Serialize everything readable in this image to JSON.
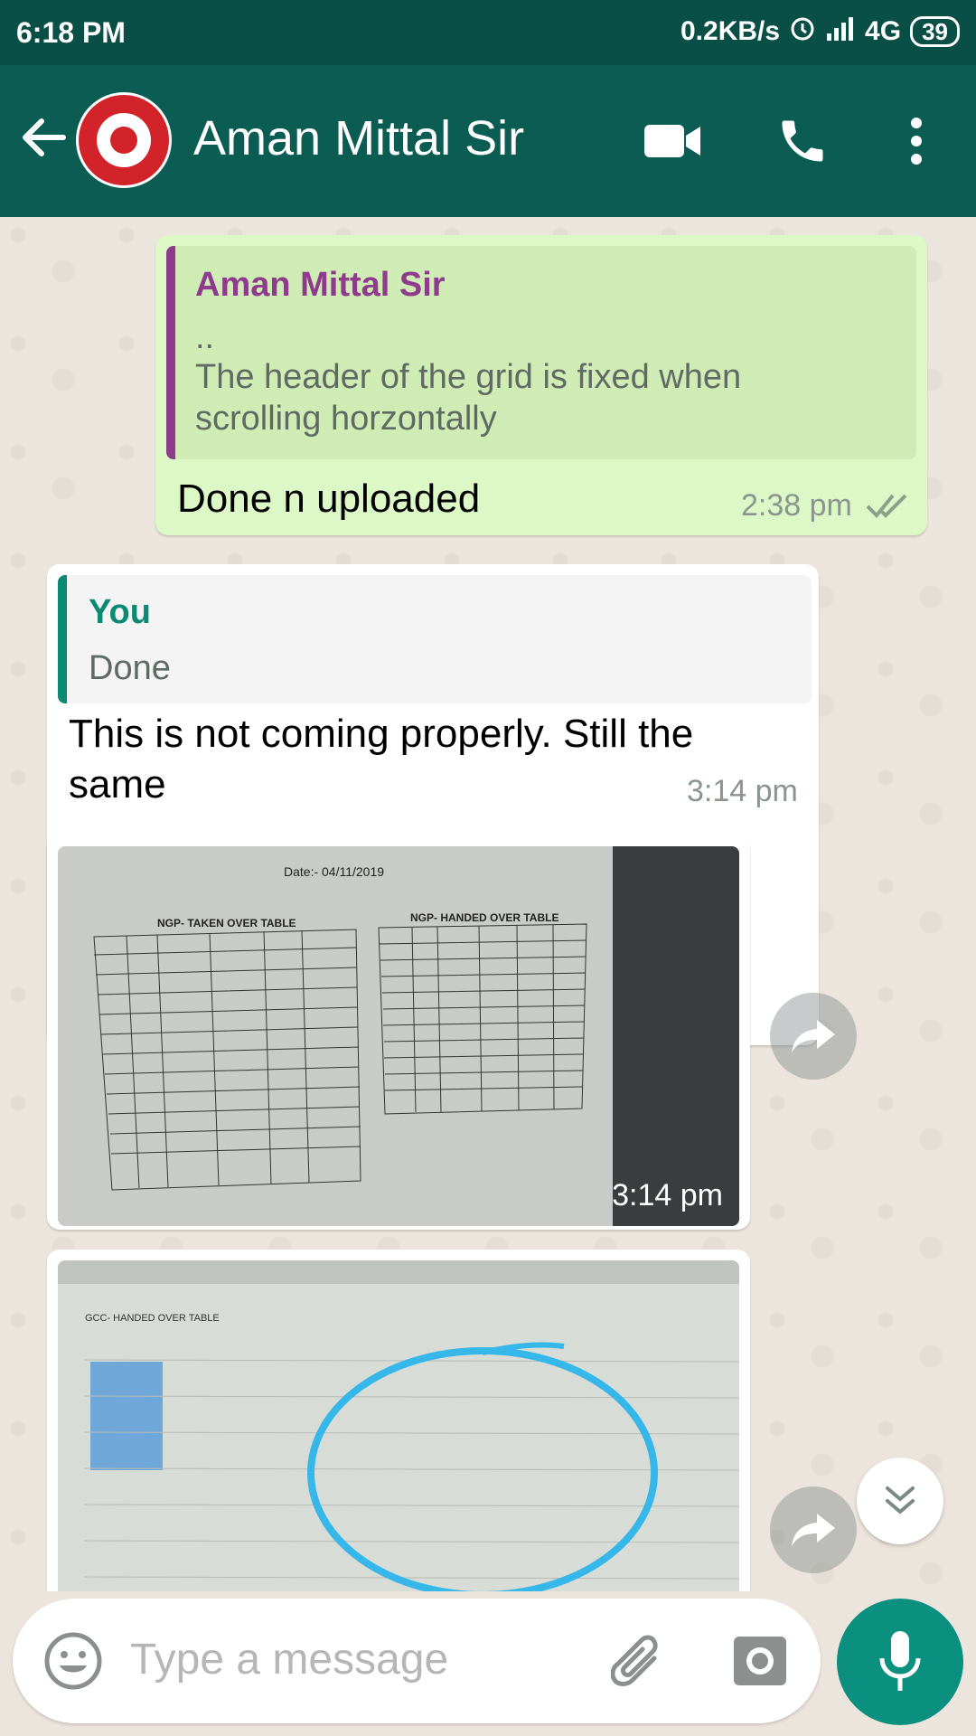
{
  "status_bar": {
    "time": "6:18 PM",
    "net_speed": "0.2KB/s",
    "network": "4G",
    "battery": "39"
  },
  "header": {
    "contact_name": "Aman Mittal Sir"
  },
  "messages": [
    {
      "direction": "outgoing",
      "quote_author": "Aman Mittal Sir",
      "quote_line1": "..",
      "quote_line2": "The header of the grid is fixed when",
      "quote_line3": "scrolling horzontally",
      "text": "Done n uploaded",
      "time": "2:38 pm"
    },
    {
      "direction": "incoming",
      "quote_author": "You",
      "quote_text": "Done",
      "text_line1": "This is not coming properly. Still the",
      "text_line2": "same",
      "time": "3:14 pm"
    },
    {
      "direction": "incoming",
      "type": "photo",
      "photo_date": "Date:- 04/11/2019",
      "table_left_title": "NGP- TAKEN OVER TABLE",
      "table_right_title": "NGP- HANDED OVER TABLE",
      "time": "3:14 pm"
    },
    {
      "direction": "incoming",
      "type": "photo",
      "table_title": "GCC- HANDED OVER TABLE"
    }
  ],
  "composer": {
    "placeholder": "Type a message"
  },
  "colors": {
    "header_bg": "#0b5c53",
    "status_bg": "#0a4f45",
    "outgoing_bubble": "#dcf8c6",
    "incoming_bubble": "#ffffff",
    "quote_author_out": "#8e3b8e",
    "quote_author_in": "#0a8a72",
    "mic_button": "#0b8f7e"
  }
}
